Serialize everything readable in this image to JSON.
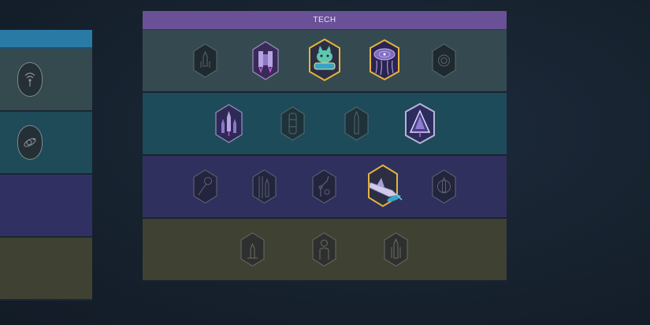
{
  "tech_panel": {
    "title": "TECH",
    "rows": [
      {
        "badges": [
          {
            "icon": "rocket-launch-icon",
            "unlocked": false
          },
          {
            "icon": "twin-boosters-icon",
            "unlocked": true
          },
          {
            "icon": "space-cat-icon",
            "unlocked": true,
            "gold": true
          },
          {
            "icon": "vinyl-record-icon",
            "unlocked": true,
            "gold": true
          },
          {
            "icon": "radar-circle-icon",
            "unlocked": false
          }
        ]
      },
      {
        "badges": [
          {
            "icon": "triple-rocket-icon",
            "unlocked": true
          },
          {
            "icon": "capsule-stack-icon",
            "unlocked": false
          },
          {
            "icon": "tall-rocket-icon",
            "unlocked": false
          },
          {
            "icon": "delta-shuttle-icon",
            "unlocked": true,
            "silver": true
          }
        ]
      },
      {
        "badges": [
          {
            "icon": "planet-satellite-icon",
            "unlocked": false
          },
          {
            "icon": "launch-tower-icon",
            "unlocked": false
          },
          {
            "icon": "robotic-arm-icon",
            "unlocked": false
          },
          {
            "icon": "space-shuttle-icon",
            "unlocked": true,
            "gold": true
          },
          {
            "icon": "orbit-rocket-icon",
            "unlocked": false
          }
        ]
      },
      {
        "badges": [
          {
            "icon": "small-rocket-icon",
            "unlocked": false
          },
          {
            "icon": "astronaut-icon",
            "unlocked": false
          },
          {
            "icon": "shuttle-launch-icon",
            "unlocked": false
          }
        ]
      }
    ]
  },
  "left_panel": {
    "badges": [
      {
        "icon": "signal-antenna-icon"
      },
      {
        "icon": "satellite-orbit-icon"
      }
    ]
  },
  "colors": {
    "tech_header": "#6a5197",
    "row_0": "#354a50",
    "row_1": "#1e4b5a",
    "row_2": "#30305f",
    "row_3": "#3f4133",
    "gold_border": "#e4b43c",
    "silver_border": "#b9b3d6"
  }
}
